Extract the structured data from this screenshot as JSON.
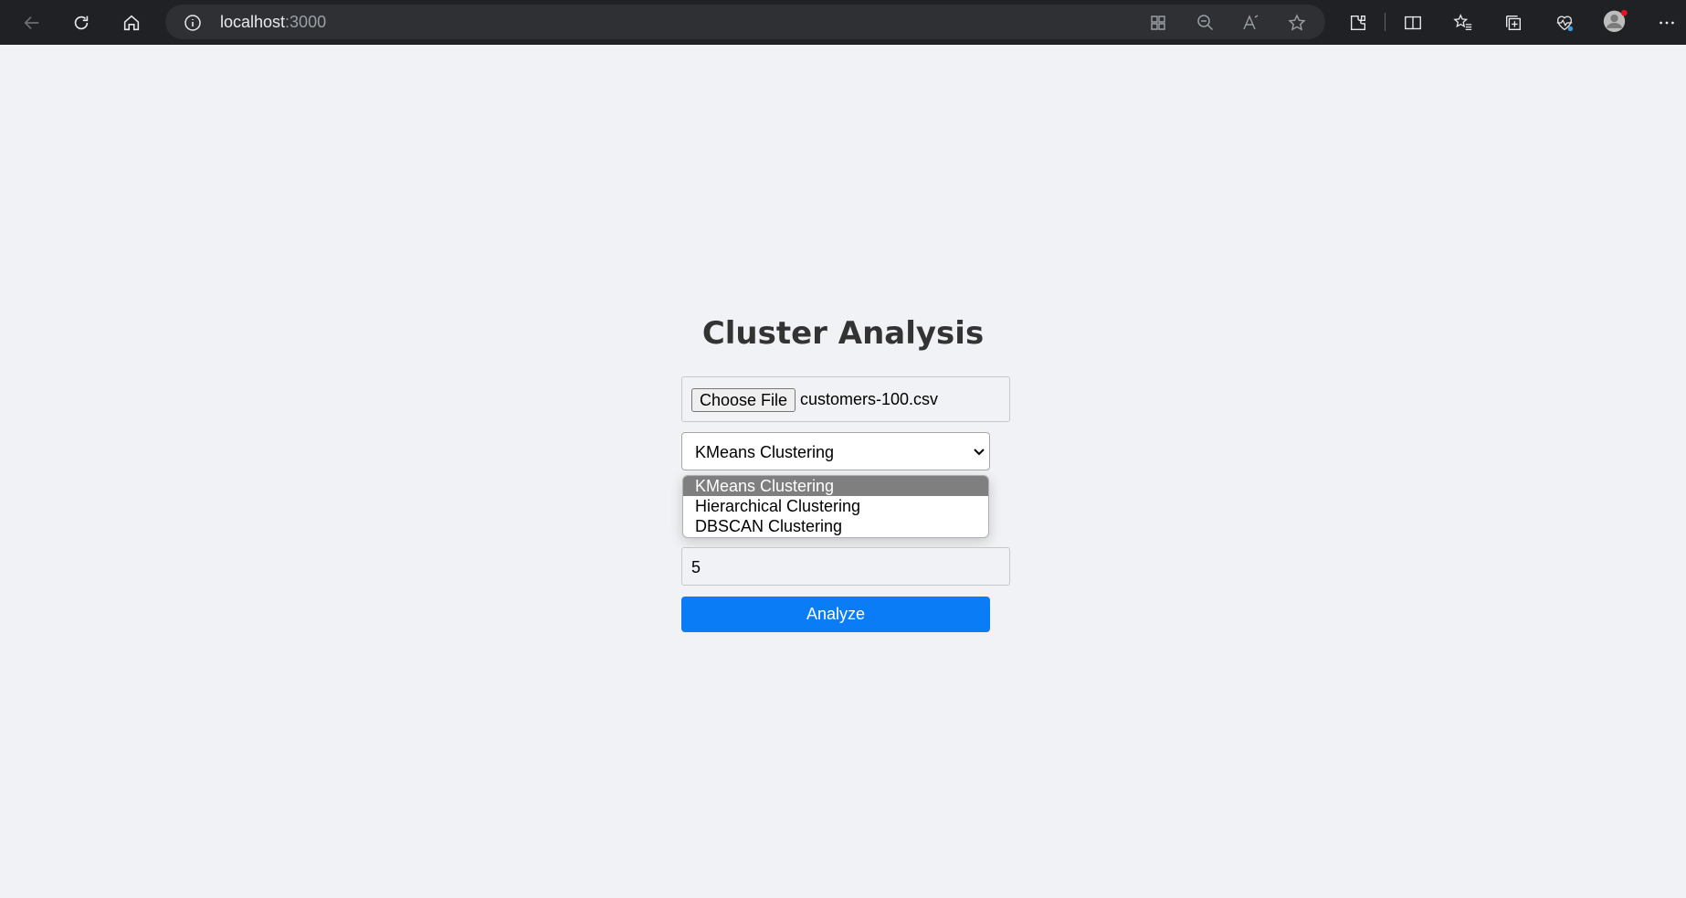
{
  "browser": {
    "url_host": "localhost",
    "url_port": ":3000",
    "icons": [
      "back-icon",
      "refresh-icon",
      "home-icon",
      "info-icon",
      "app-icon",
      "zoom-out-icon",
      "read-aloud-icon",
      "favorite-star-icon",
      "extensions-icon",
      "split-screen-icon",
      "favorites-icon",
      "collections-icon",
      "browser-essentials-icon",
      "profile-avatar",
      "more-options-icon"
    ],
    "notification_color": "#e81123"
  },
  "page": {
    "title": "Cluster Analysis",
    "file_button_label": "Choose File",
    "file_name": "customers-100.csv",
    "algorithm_selected": "KMeans Clustering",
    "algorithm_options": [
      "KMeans Clustering",
      "Hierarchical Clustering",
      "DBSCAN Clustering"
    ],
    "clusters_value": "5",
    "analyze_label": "Analyze",
    "accent_color": "#0a7cf5"
  }
}
